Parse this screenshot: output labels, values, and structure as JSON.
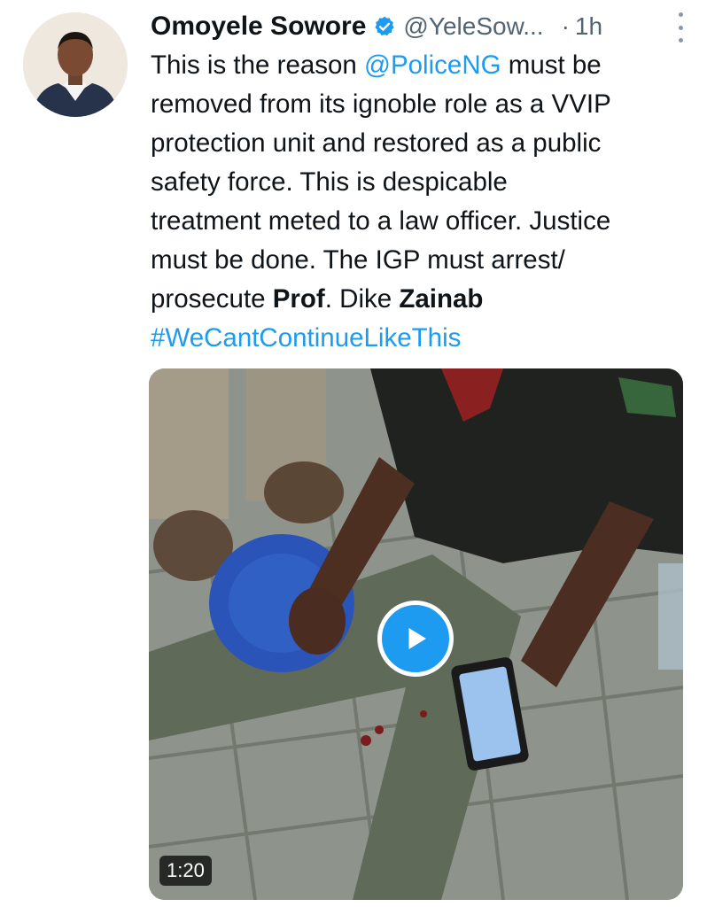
{
  "author": {
    "display_name": "Omoyele Sowore",
    "handle": "@YeleSow...",
    "separator": "·",
    "time": "1h",
    "avatar_icon": "profile-photo",
    "verified_icon": "verified-badge-icon"
  },
  "tweet": {
    "line1_pre": "This is the reason ",
    "line1_mention": "@PoliceNG",
    "line1_post": " must be",
    "line2": "removed from its ignoble role as a VVIP",
    "line3": "protection unit and restored as a public",
    "line4": "safety force. This is despicable",
    "line5": "treatment meted to a law officer. Justice",
    "line6": "must be done. The IGP must arrest/",
    "line7_pre": "prosecute ",
    "line7_bold1": "Prof",
    "line7_mid": ". Dike ",
    "line7_bold2": "Zainab",
    "hashtag": "#WeCantContinueLikeThis"
  },
  "media": {
    "type": "video",
    "duration": "1:20",
    "play_icon": "play-icon"
  },
  "colors": {
    "link": "#1d9bf0",
    "secondary_text": "#536471",
    "primary_text": "#0f1419"
  }
}
